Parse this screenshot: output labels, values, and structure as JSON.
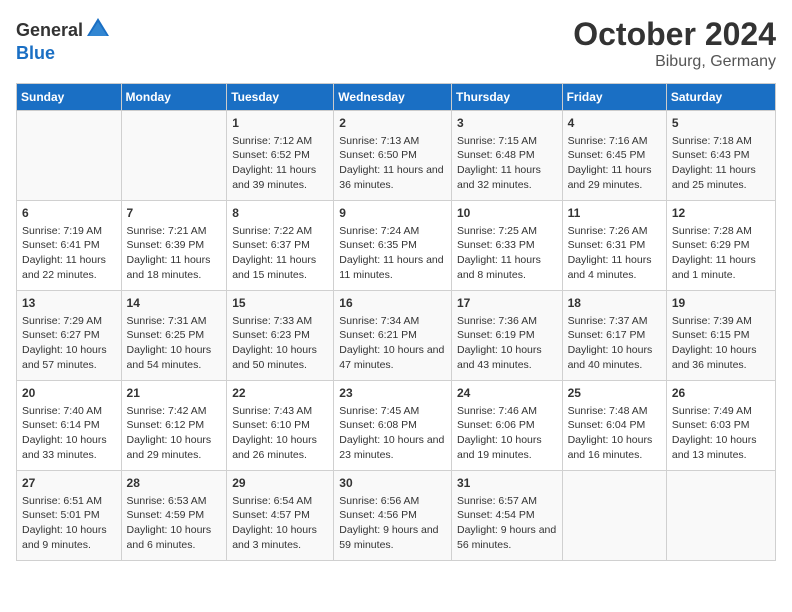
{
  "header": {
    "logo_line1": "General",
    "logo_line2": "Blue",
    "month": "October 2024",
    "location": "Biburg, Germany"
  },
  "weekdays": [
    "Sunday",
    "Monday",
    "Tuesday",
    "Wednesday",
    "Thursday",
    "Friday",
    "Saturday"
  ],
  "weeks": [
    [
      {
        "day": "",
        "info": ""
      },
      {
        "day": "",
        "info": ""
      },
      {
        "day": "1",
        "info": "Sunrise: 7:12 AM\nSunset: 6:52 PM\nDaylight: 11 hours and 39 minutes."
      },
      {
        "day": "2",
        "info": "Sunrise: 7:13 AM\nSunset: 6:50 PM\nDaylight: 11 hours and 36 minutes."
      },
      {
        "day": "3",
        "info": "Sunrise: 7:15 AM\nSunset: 6:48 PM\nDaylight: 11 hours and 32 minutes."
      },
      {
        "day": "4",
        "info": "Sunrise: 7:16 AM\nSunset: 6:45 PM\nDaylight: 11 hours and 29 minutes."
      },
      {
        "day": "5",
        "info": "Sunrise: 7:18 AM\nSunset: 6:43 PM\nDaylight: 11 hours and 25 minutes."
      }
    ],
    [
      {
        "day": "6",
        "info": "Sunrise: 7:19 AM\nSunset: 6:41 PM\nDaylight: 11 hours and 22 minutes."
      },
      {
        "day": "7",
        "info": "Sunrise: 7:21 AM\nSunset: 6:39 PM\nDaylight: 11 hours and 18 minutes."
      },
      {
        "day": "8",
        "info": "Sunrise: 7:22 AM\nSunset: 6:37 PM\nDaylight: 11 hours and 15 minutes."
      },
      {
        "day": "9",
        "info": "Sunrise: 7:24 AM\nSunset: 6:35 PM\nDaylight: 11 hours and 11 minutes."
      },
      {
        "day": "10",
        "info": "Sunrise: 7:25 AM\nSunset: 6:33 PM\nDaylight: 11 hours and 8 minutes."
      },
      {
        "day": "11",
        "info": "Sunrise: 7:26 AM\nSunset: 6:31 PM\nDaylight: 11 hours and 4 minutes."
      },
      {
        "day": "12",
        "info": "Sunrise: 7:28 AM\nSunset: 6:29 PM\nDaylight: 11 hours and 1 minute."
      }
    ],
    [
      {
        "day": "13",
        "info": "Sunrise: 7:29 AM\nSunset: 6:27 PM\nDaylight: 10 hours and 57 minutes."
      },
      {
        "day": "14",
        "info": "Sunrise: 7:31 AM\nSunset: 6:25 PM\nDaylight: 10 hours and 54 minutes."
      },
      {
        "day": "15",
        "info": "Sunrise: 7:33 AM\nSunset: 6:23 PM\nDaylight: 10 hours and 50 minutes."
      },
      {
        "day": "16",
        "info": "Sunrise: 7:34 AM\nSunset: 6:21 PM\nDaylight: 10 hours and 47 minutes."
      },
      {
        "day": "17",
        "info": "Sunrise: 7:36 AM\nSunset: 6:19 PM\nDaylight: 10 hours and 43 minutes."
      },
      {
        "day": "18",
        "info": "Sunrise: 7:37 AM\nSunset: 6:17 PM\nDaylight: 10 hours and 40 minutes."
      },
      {
        "day": "19",
        "info": "Sunrise: 7:39 AM\nSunset: 6:15 PM\nDaylight: 10 hours and 36 minutes."
      }
    ],
    [
      {
        "day": "20",
        "info": "Sunrise: 7:40 AM\nSunset: 6:14 PM\nDaylight: 10 hours and 33 minutes."
      },
      {
        "day": "21",
        "info": "Sunrise: 7:42 AM\nSunset: 6:12 PM\nDaylight: 10 hours and 29 minutes."
      },
      {
        "day": "22",
        "info": "Sunrise: 7:43 AM\nSunset: 6:10 PM\nDaylight: 10 hours and 26 minutes."
      },
      {
        "day": "23",
        "info": "Sunrise: 7:45 AM\nSunset: 6:08 PM\nDaylight: 10 hours and 23 minutes."
      },
      {
        "day": "24",
        "info": "Sunrise: 7:46 AM\nSunset: 6:06 PM\nDaylight: 10 hours and 19 minutes."
      },
      {
        "day": "25",
        "info": "Sunrise: 7:48 AM\nSunset: 6:04 PM\nDaylight: 10 hours and 16 minutes."
      },
      {
        "day": "26",
        "info": "Sunrise: 7:49 AM\nSunset: 6:03 PM\nDaylight: 10 hours and 13 minutes."
      }
    ],
    [
      {
        "day": "27",
        "info": "Sunrise: 6:51 AM\nSunset: 5:01 PM\nDaylight: 10 hours and 9 minutes."
      },
      {
        "day": "28",
        "info": "Sunrise: 6:53 AM\nSunset: 4:59 PM\nDaylight: 10 hours and 6 minutes."
      },
      {
        "day": "29",
        "info": "Sunrise: 6:54 AM\nSunset: 4:57 PM\nDaylight: 10 hours and 3 minutes."
      },
      {
        "day": "30",
        "info": "Sunrise: 6:56 AM\nSunset: 4:56 PM\nDaylight: 9 hours and 59 minutes."
      },
      {
        "day": "31",
        "info": "Sunrise: 6:57 AM\nSunset: 4:54 PM\nDaylight: 9 hours and 56 minutes."
      },
      {
        "day": "",
        "info": ""
      },
      {
        "day": "",
        "info": ""
      }
    ]
  ]
}
